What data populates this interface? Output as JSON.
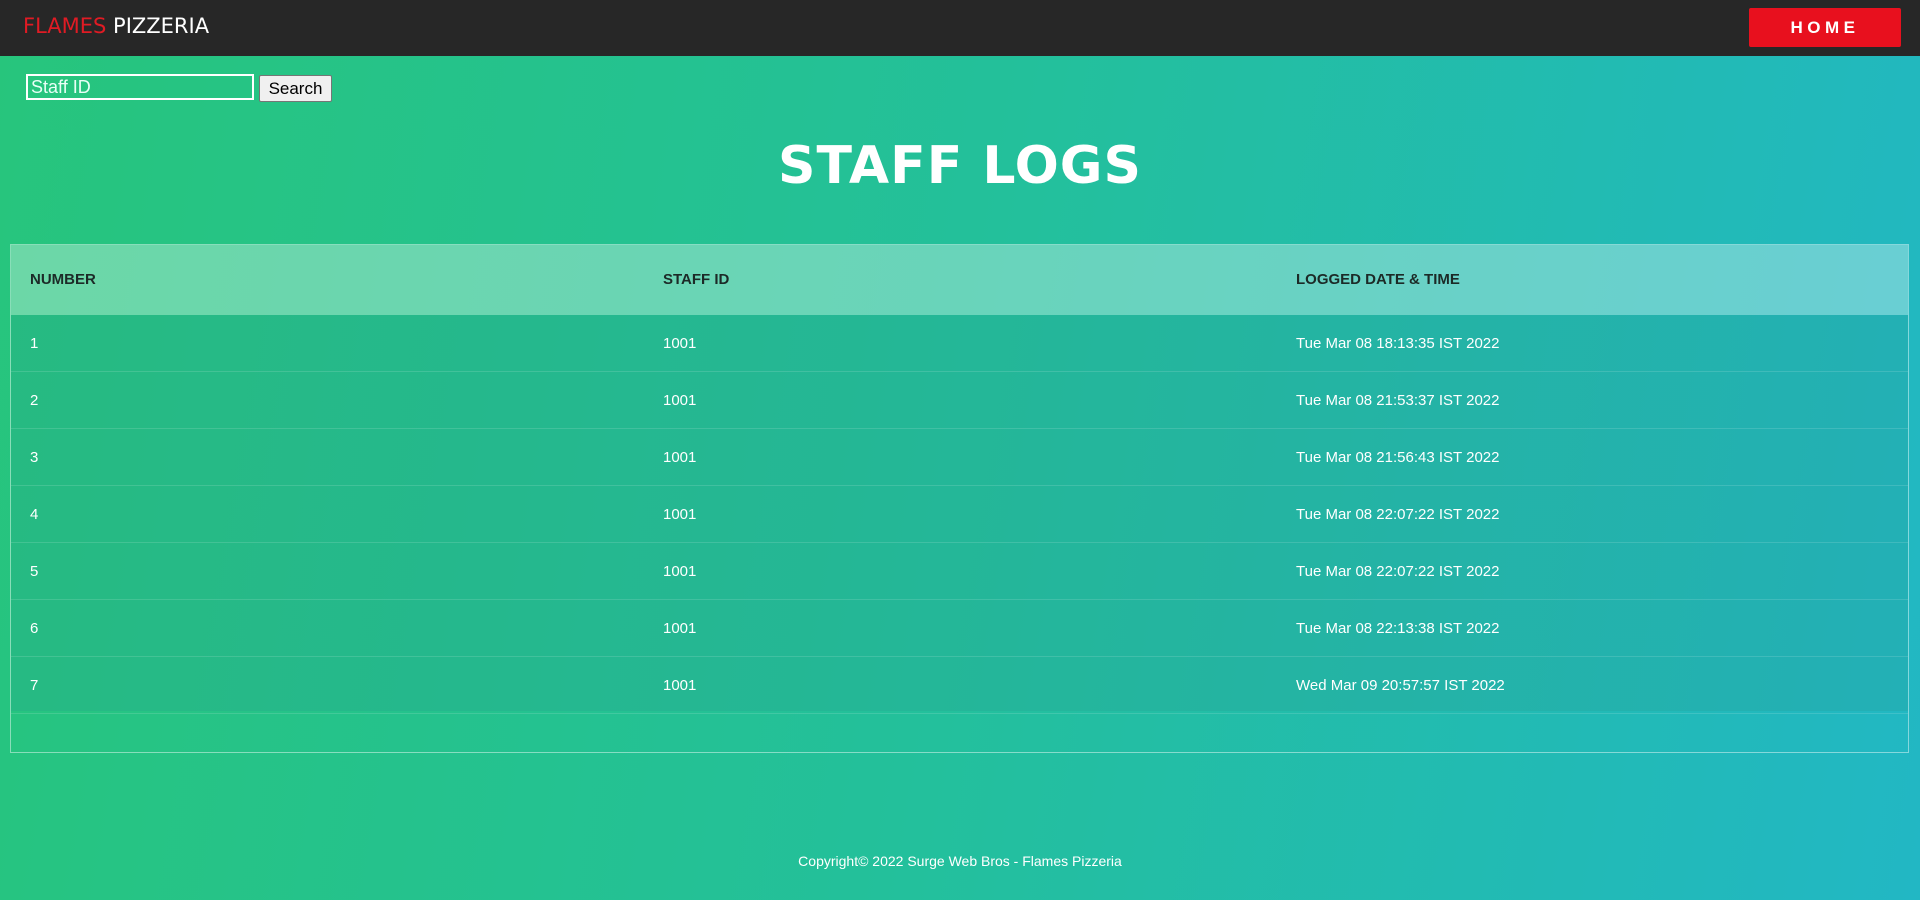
{
  "navbar": {
    "brand_red": "FLAMES",
    "brand_white": "PIZZERIA",
    "home_label": "HOME"
  },
  "search": {
    "placeholder": "Staff ID",
    "button_label": "Search"
  },
  "page_title": "STAFF LOGS",
  "table": {
    "headers": [
      "NUMBER",
      "STAFF ID",
      "LOGGED DATE & TIME"
    ],
    "rows": [
      [
        "1",
        "1001",
        "Tue Mar 08 18:13:35 IST 2022"
      ],
      [
        "2",
        "1001",
        "Tue Mar 08 21:53:37 IST 2022"
      ],
      [
        "3",
        "1001",
        "Tue Mar 08 21:56:43 IST 2022"
      ],
      [
        "4",
        "1001",
        "Tue Mar 08 22:07:22 IST 2022"
      ],
      [
        "5",
        "1001",
        "Tue Mar 08 22:07:22 IST 2022"
      ],
      [
        "6",
        "1001",
        "Tue Mar 08 22:13:38 IST 2022"
      ],
      [
        "7",
        "1001",
        "Wed Mar 09 20:57:57 IST 2022"
      ]
    ]
  },
  "footer": "Copyright© 2022 Surge Web Bros - Flames Pizzeria",
  "colors": {
    "brand_red": "#e01b24",
    "home_button": "#e8101e",
    "navbar_bg": "#272727",
    "gradient_start": "#27c57c",
    "gradient_end": "#22b7c4"
  }
}
